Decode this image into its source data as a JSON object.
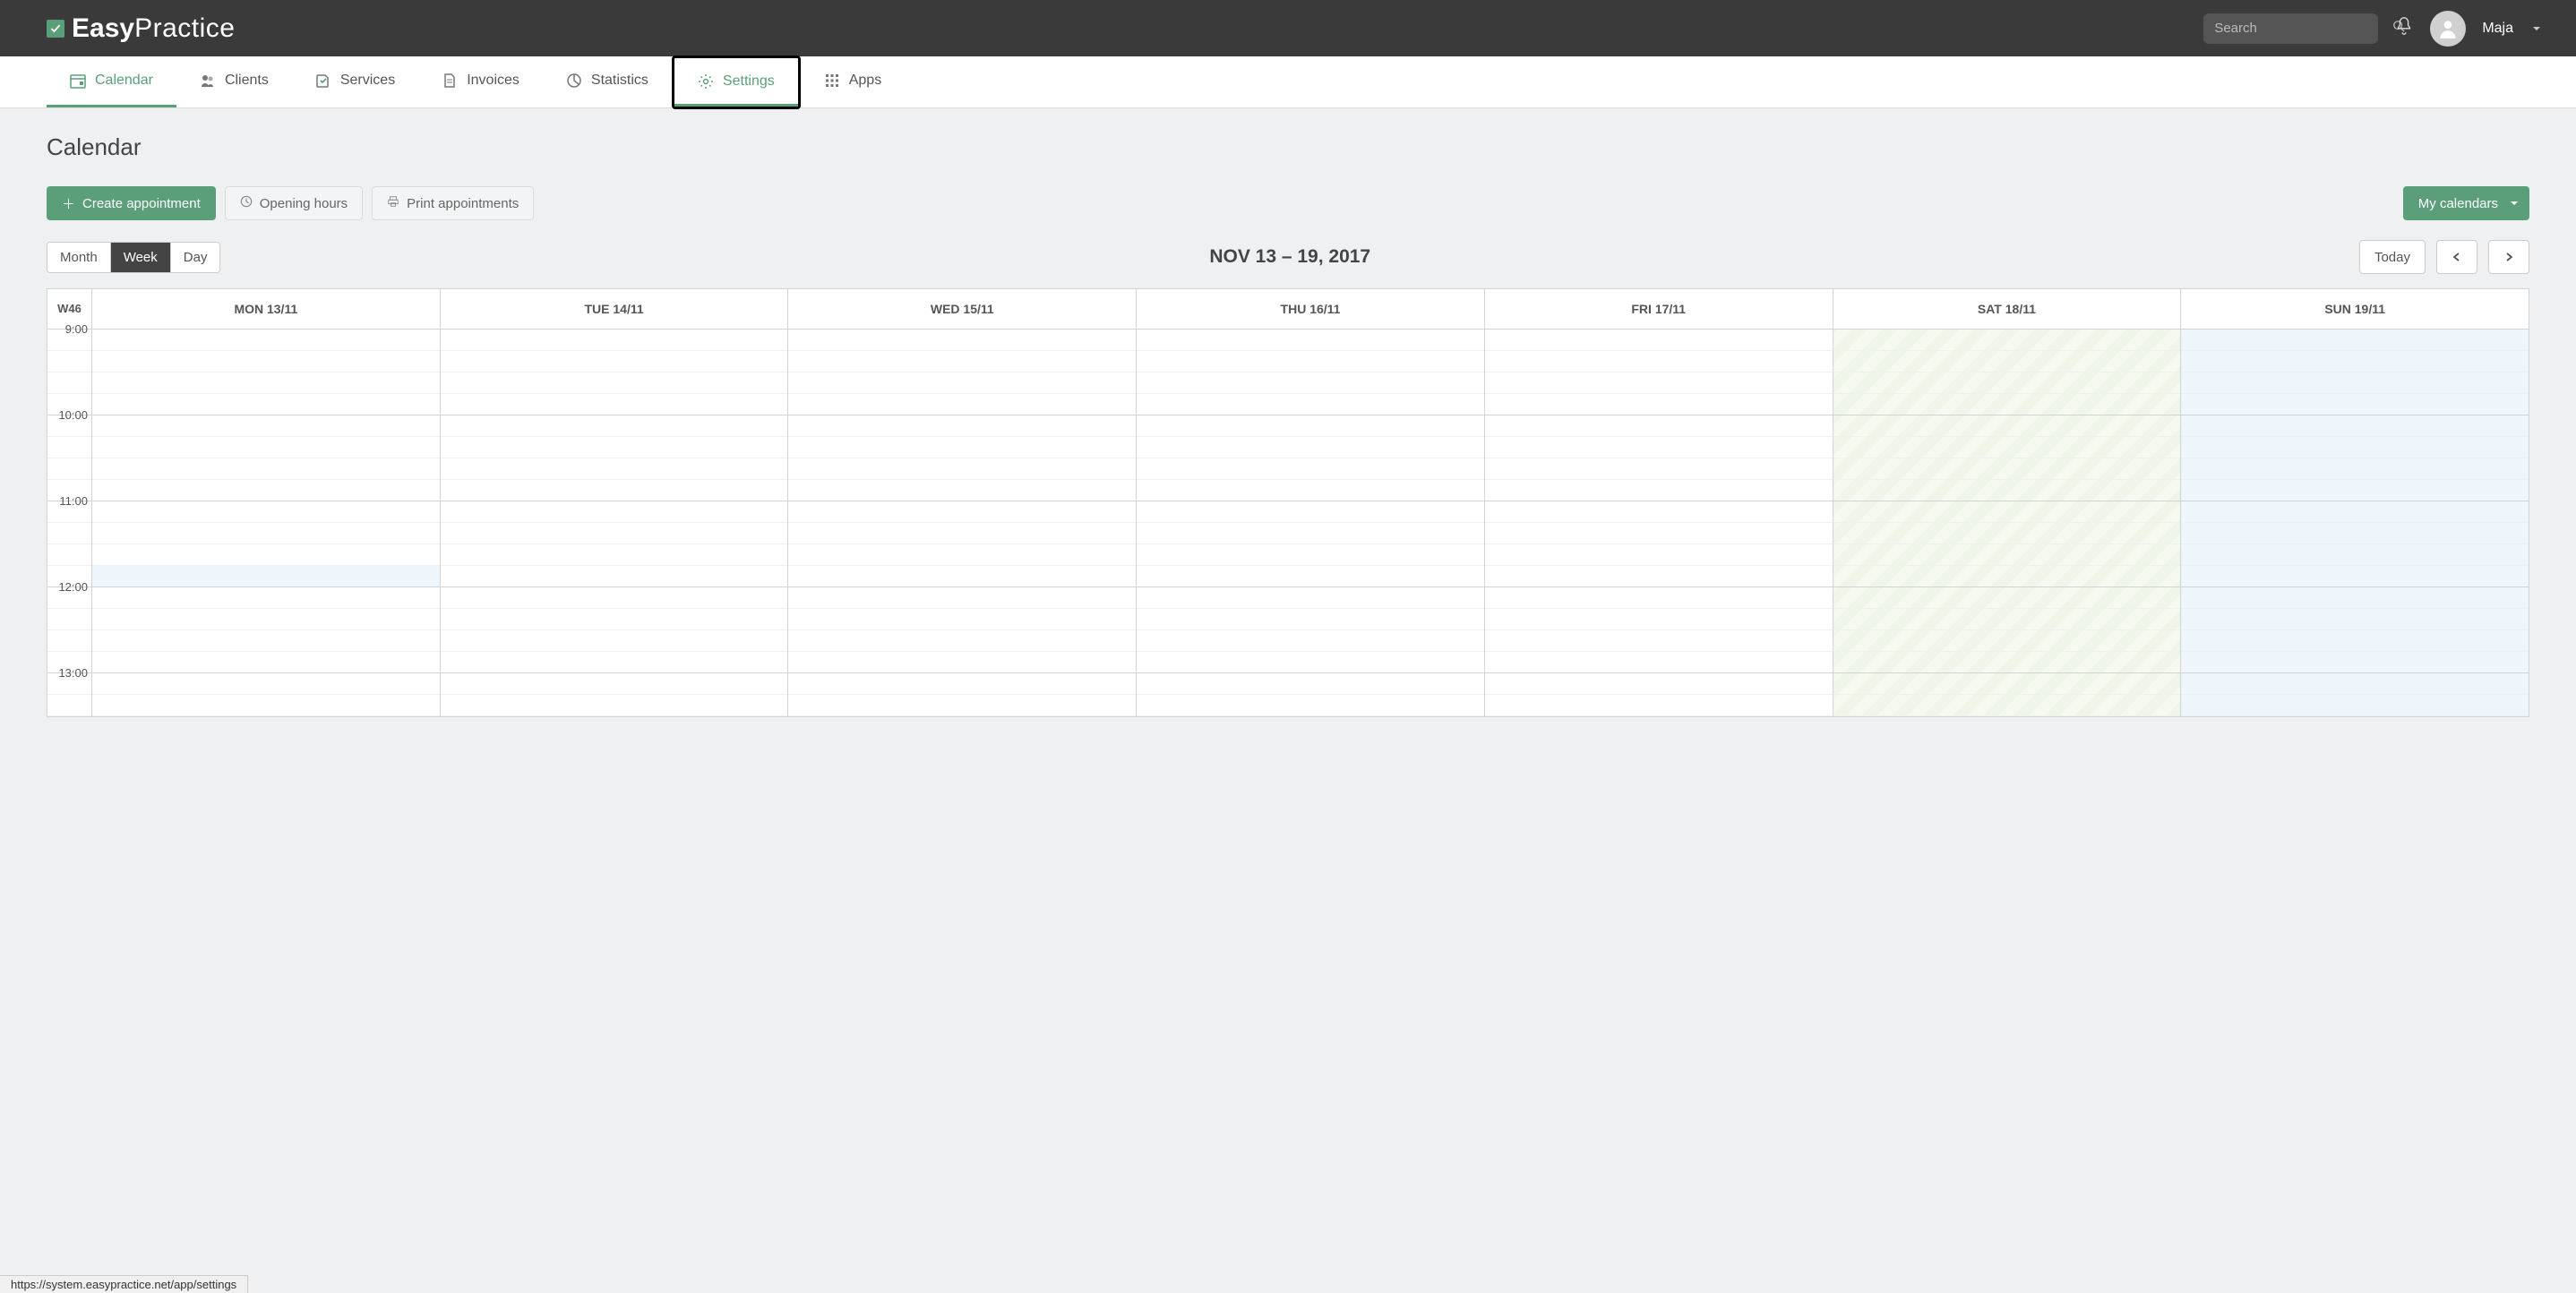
{
  "app": {
    "logo_easy": "Easy",
    "logo_practice": "Practice"
  },
  "search": {
    "placeholder": "Search"
  },
  "user": {
    "name": "Maja"
  },
  "nav": {
    "calendar": "Calendar",
    "clients": "Clients",
    "services": "Services",
    "invoices": "Invoices",
    "statistics": "Statistics",
    "settings": "Settings",
    "apps": "Apps"
  },
  "page": {
    "title": "Calendar"
  },
  "toolbar": {
    "create": "Create appointment",
    "opening_hours": "Opening hours",
    "print": "Print appointments",
    "my_calendars": "My calendars"
  },
  "views": {
    "month": "Month",
    "week": "Week",
    "day": "Day"
  },
  "range": {
    "title": "NOV 13 – 19, 2017",
    "today": "Today"
  },
  "calendar": {
    "week_label": "W46",
    "days": [
      "MON 13/11",
      "TUE 14/11",
      "WED 15/11",
      "THU 16/11",
      "FRI 17/11",
      "SAT 18/11",
      "SUN 19/11"
    ],
    "hours": [
      "9:00",
      "10:00",
      "11:00",
      "12:00",
      "13:00"
    ]
  },
  "status_url": "https://system.easypractice.net/app/settings"
}
